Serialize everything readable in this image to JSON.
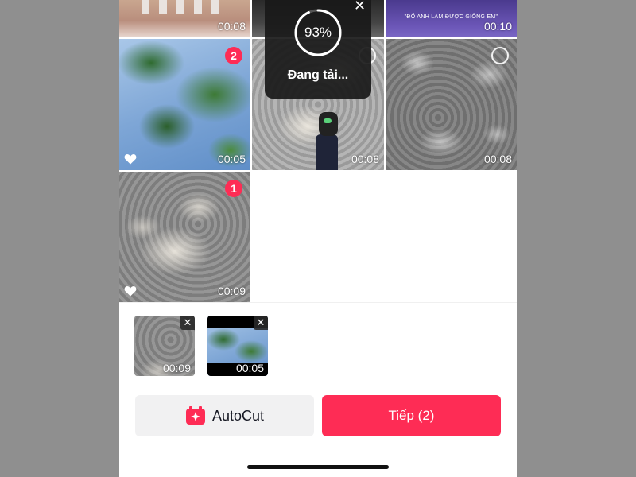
{
  "grid": {
    "row0": [
      {
        "duration": "00:08"
      },
      {
        "duration": ""
      },
      {
        "caption": "\"ĐỔ ANH LÀM ĐƯỢC GIỐNG EM\"",
        "duration": "00:10"
      }
    ],
    "row1": [
      {
        "selection": "2",
        "duration": "00:05"
      },
      {
        "duration": "00:08"
      },
      {
        "duration": "00:08"
      }
    ],
    "row2": [
      {
        "selection": "1",
        "duration": "00:09"
      }
    ]
  },
  "loading": {
    "percent_text": "93%",
    "percent_value": 93,
    "label": "Đang tải...",
    "close": "✕"
  },
  "selected": [
    {
      "duration": "00:09",
      "remove": "✕"
    },
    {
      "duration": "00:05",
      "remove": "✕"
    }
  ],
  "actions": {
    "autocut_label": "AutoCut",
    "next_label": "Tiếp (2)"
  },
  "colors": {
    "accent": "#fe2c55",
    "autocut_bg": "#f1f1f2",
    "overlay": "#191919"
  },
  "icons": {
    "heart": "heart-icon",
    "autocut": "autocut-sparkle-icon",
    "close": "close-icon"
  }
}
